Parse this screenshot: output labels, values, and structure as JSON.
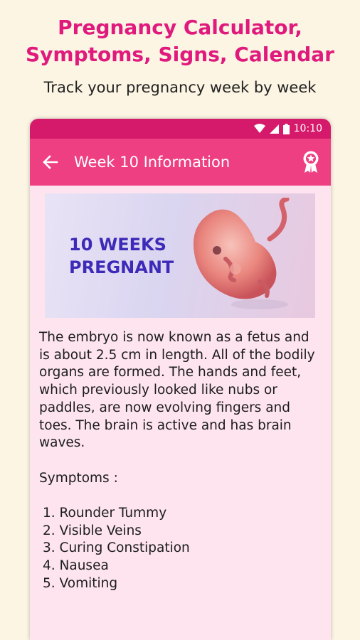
{
  "promo": {
    "title_line1": "Pregnancy Calculator,",
    "title_line2": "Symptoms, Signs, Calendar",
    "subtitle": "Track your pregnancy week by week"
  },
  "status_bar": {
    "time": "10:10"
  },
  "toolbar": {
    "title": "Week 10 Information"
  },
  "banner": {
    "line1": "10 WEEKS",
    "line2": "PREGNANT"
  },
  "content": {
    "paragraph": "The embryo is now known as a fetus and is about 2.5 cm in length. All of the bodily organs are formed. The hands and feet, which previously looked like nubs or paddles, are now evolving fingers and toes. The brain is active and has brain waves.",
    "symptoms_heading": "Symptoms :",
    "symptoms": [
      "1. Rounder Tummy",
      "2. Visible Veins",
      "3. Curing Constipation",
      "4. Nausea",
      "5. Vomiting"
    ]
  },
  "colors": {
    "accent": "#e0197c",
    "status_bar": "#d61a6b",
    "toolbar": "#ee3f82",
    "page_bg": "#fde4ef",
    "banner_text": "#3d2ab8"
  },
  "icons": [
    "wifi-icon",
    "signal-icon",
    "battery-icon",
    "back-arrow-icon",
    "award-badge-icon"
  ]
}
